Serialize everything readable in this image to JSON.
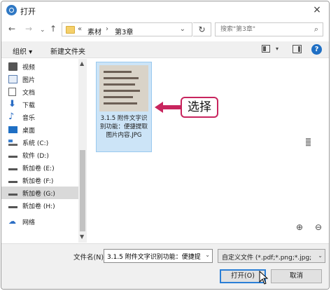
{
  "title_bar": {
    "title": "打开",
    "close_label": "×"
  },
  "nav": {
    "back": "←",
    "forward": "→",
    "recent": "⌄",
    "up": "↑"
  },
  "address": {
    "chevron": "«",
    "crumbs": [
      "素材",
      "第3章"
    ],
    "separator": "›",
    "dropdown": "⌄",
    "refresh": "↻"
  },
  "search": {
    "placeholder": "搜索\"第3章\""
  },
  "toolbar": {
    "organize": "组织 ▾",
    "new_folder": "新建文件夹",
    "view_dropdown": "▾",
    "help": "?"
  },
  "sidebar": {
    "items": [
      {
        "label": "视频",
        "icon": "video-icon"
      },
      {
        "label": "图片",
        "icon": "pictures-icon"
      },
      {
        "label": "文档",
        "icon": "documents-icon"
      },
      {
        "label": "下载",
        "icon": "download-icon"
      },
      {
        "label": "音乐",
        "icon": "music-icon"
      },
      {
        "label": "桌面",
        "icon": "desktop-icon"
      },
      {
        "label": "系统 (C:)",
        "icon": "system-drive-icon"
      },
      {
        "label": "软件 (D:)",
        "icon": "drive-icon"
      },
      {
        "label": "新加卷 (E:)",
        "icon": "drive-icon"
      },
      {
        "label": "新加卷 (F:)",
        "icon": "drive-icon"
      },
      {
        "label": "新加卷 (G:)",
        "icon": "drive-icon",
        "selected": true
      },
      {
        "label": "新加卷 (H:)",
        "icon": "drive-icon"
      },
      {
        "label": "网络",
        "icon": "network-icon"
      }
    ]
  },
  "files": [
    {
      "name": "3.1.5 附件文字识别功能：便捷提取图片内容.JPG",
      "selected": true
    }
  ],
  "callout": {
    "text": "选择"
  },
  "zoom": {
    "in": "⊕",
    "out": "⊖"
  },
  "bottom": {
    "filename_label": "文件名(N):",
    "filename_value": "3.1.5 附件文字识别功能：便捷提",
    "filetype_value": "自定义文件 (*.pdf;*.png;*.jpg;",
    "open_button": "打开(O)",
    "cancel_button": "取消"
  },
  "colors": {
    "accent": "#2b7fd6",
    "callout_border": "#c8255e",
    "selection": "#cce4f7"
  }
}
